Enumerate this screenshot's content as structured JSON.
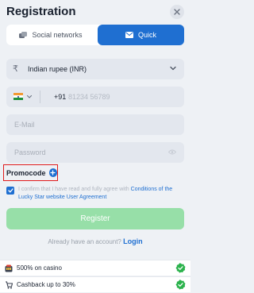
{
  "header": {
    "title": "Registration",
    "close_icon": "close-icon"
  },
  "tabs": [
    {
      "label": "Social networks",
      "icon": "social-icon",
      "active": false
    },
    {
      "label": "Quick",
      "icon": "envelope-icon",
      "active": true
    }
  ],
  "form": {
    "currency": {
      "symbol": "₹",
      "value": "Indian rupee (INR)"
    },
    "phone": {
      "country_code": "+91",
      "placeholder": "81234 56789"
    },
    "email": {
      "placeholder": "E-Mail"
    },
    "password": {
      "placeholder": "Password"
    },
    "promocode_label": "Promocode"
  },
  "agreement": {
    "text": "I confirm that I have read and fully agree with ",
    "link": "Conditions of the Lucky Star website User Agreement",
    "checked": true
  },
  "register_label": "Register",
  "login_prompt": {
    "text": "Already have an account?",
    "link": "Login"
  },
  "bonuses": [
    {
      "text": "500% on casino",
      "icon": "casino-icon"
    },
    {
      "text": "Cashback up to 30%",
      "icon": "cashback-icon"
    }
  ],
  "colors": {
    "accent": "#1f6fd1",
    "register_bg": "#97dfa8",
    "check_green": "#2bb24c",
    "highlight_red": "#e01b1b"
  }
}
